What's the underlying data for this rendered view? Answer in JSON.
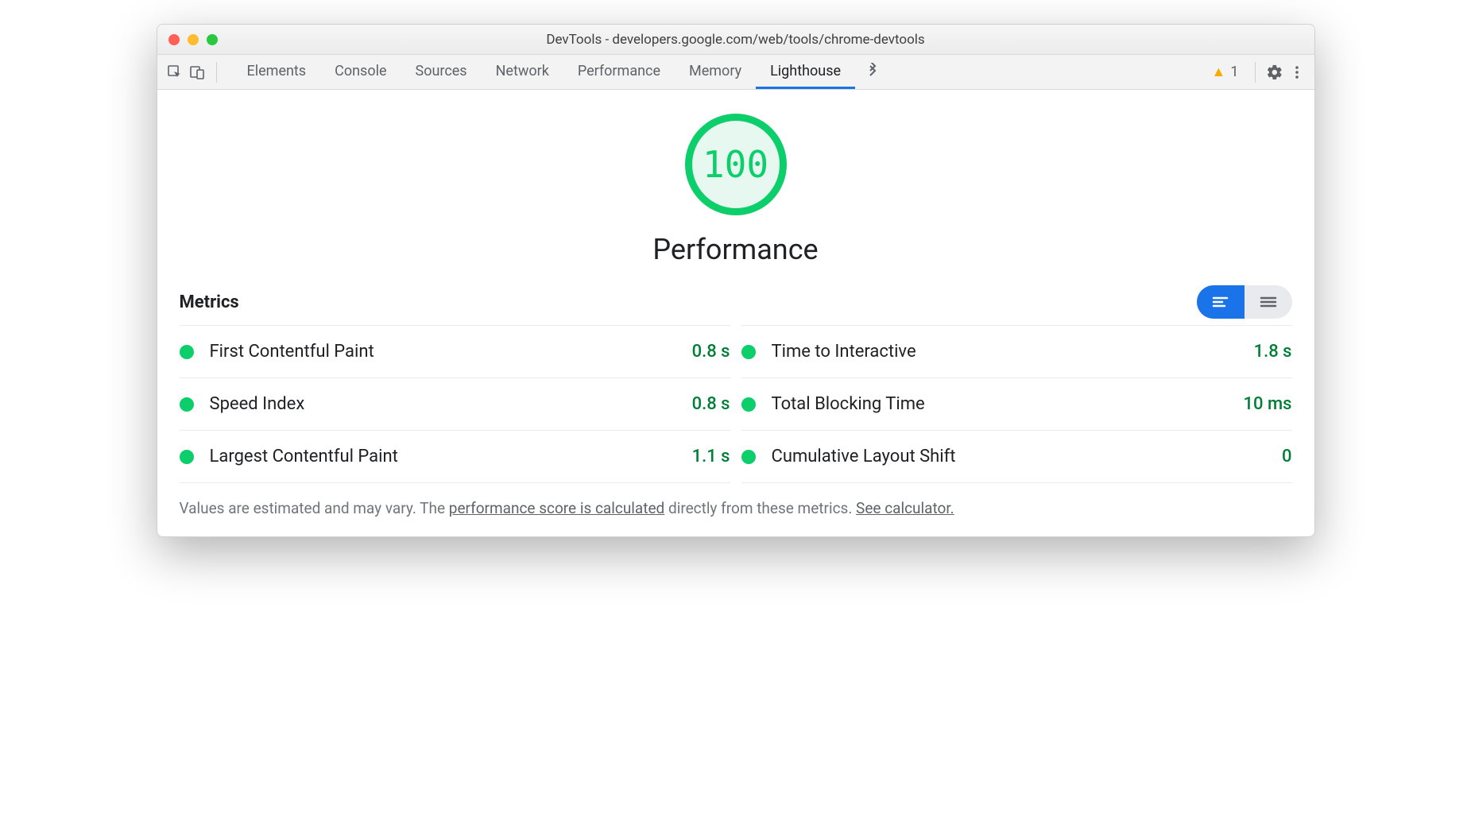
{
  "window": {
    "title": "DevTools - developers.google.com/web/tools/chrome-devtools"
  },
  "toolbar": {
    "tabs": [
      "Elements",
      "Console",
      "Sources",
      "Network",
      "Performance",
      "Memory",
      "Lighthouse"
    ],
    "active_tab": "Lighthouse",
    "warning_count": "1"
  },
  "score": {
    "value": "100",
    "label": "Performance"
  },
  "metrics": {
    "title": "Metrics",
    "left": [
      {
        "name": "First Contentful Paint",
        "value": "0.8 s"
      },
      {
        "name": "Speed Index",
        "value": "0.8 s"
      },
      {
        "name": "Largest Contentful Paint",
        "value": "1.1 s"
      }
    ],
    "right": [
      {
        "name": "Time to Interactive",
        "value": "1.8 s"
      },
      {
        "name": "Total Blocking Time",
        "value": "10 ms"
      },
      {
        "name": "Cumulative Layout Shift",
        "value": "0"
      }
    ]
  },
  "footer": {
    "prefix": "Values are estimated and may vary. The ",
    "link1": "performance score is calculated",
    "mid": " directly from these metrics. ",
    "link2": "See calculator."
  },
  "colors": {
    "accent": "#1a73e8",
    "good": "#0cce6b",
    "warning": "#f9ab00"
  }
}
